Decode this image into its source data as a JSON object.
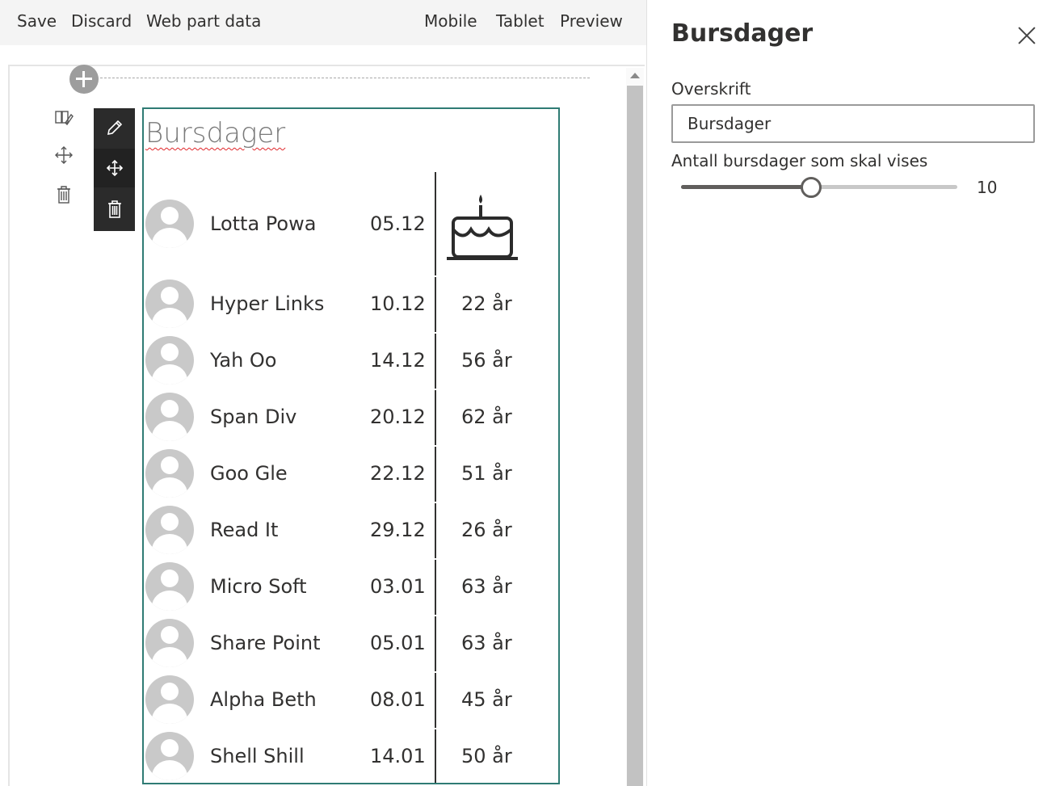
{
  "toolbar": {
    "save": "Save",
    "discard": "Discard",
    "webpart_data": "Web part data",
    "mobile": "Mobile",
    "tablet": "Tablet",
    "preview": "Preview"
  },
  "webpart": {
    "title": "Bursdager",
    "cake_icon": "birthday-cake-icon",
    "rows": [
      {
        "name": "Lotta Powa",
        "date": "05.12",
        "age": ""
      },
      {
        "name": "Hyper Links",
        "date": "10.12",
        "age": "22 år"
      },
      {
        "name": "Yah Oo",
        "date": "14.12",
        "age": "56 år"
      },
      {
        "name": "Span Div",
        "date": "20.12",
        "age": "62 år"
      },
      {
        "name": "Goo Gle",
        "date": "22.12",
        "age": "51 år"
      },
      {
        "name": "Read It",
        "date": "29.12",
        "age": "26 år"
      },
      {
        "name": "Micro Soft",
        "date": "03.01",
        "age": "63 år"
      },
      {
        "name": "Share Point",
        "date": "05.01",
        "age": "63 år"
      },
      {
        "name": "Alpha Beth",
        "date": "08.01",
        "age": "45 år"
      },
      {
        "name": "Shell Shill",
        "date": "14.01",
        "age": "50 år"
      }
    ]
  },
  "pane": {
    "title": "Bursdager",
    "heading_label": "Overskrift",
    "heading_value": "Bursdager",
    "count_label": "Antall bursdager som skal vises",
    "count_value": "10",
    "count_fraction": 0.47
  },
  "colors": {
    "accent": "#2f7b74",
    "toolbar_dark": "#2b2b2b"
  }
}
